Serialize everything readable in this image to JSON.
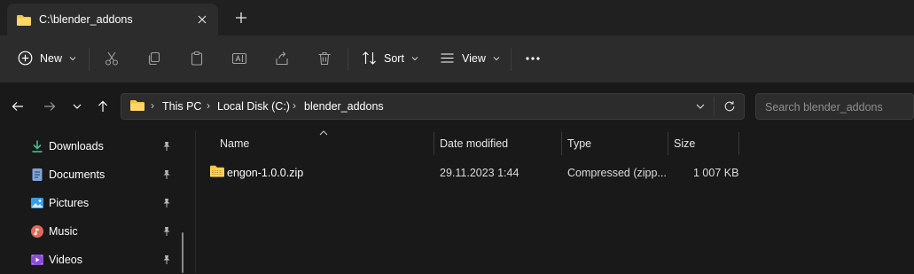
{
  "window": {
    "tab_title": "C:\\blender_addons",
    "new_tab_label": "+"
  },
  "toolbar": {
    "new_label": "New",
    "sort_label": "Sort",
    "view_label": "View",
    "more_label": "···"
  },
  "address": {
    "crumbs": [
      "This PC",
      "Local Disk (C:)",
      "blender_addons"
    ]
  },
  "search": {
    "placeholder": "Search blender_addons",
    "value": ""
  },
  "sidebar": {
    "items": [
      {
        "label": "Downloads",
        "icon": "download-icon"
      },
      {
        "label": "Documents",
        "icon": "document-icon"
      },
      {
        "label": "Pictures",
        "icon": "pictures-icon"
      },
      {
        "label": "Music",
        "icon": "music-icon"
      },
      {
        "label": "Videos",
        "icon": "videos-icon"
      }
    ]
  },
  "file_list": {
    "columns": [
      "Name",
      "Date modified",
      "Type",
      "Size"
    ],
    "rows": [
      {
        "name": "engon-1.0.0.zip",
        "date": "29.11.2023 1:44",
        "type": "Compressed (zipp...",
        "size": "1 007 KB"
      }
    ]
  },
  "colors": {
    "background": "#191919",
    "toolbar": "#2c2c2c",
    "folder": "#f4c542",
    "accent": "#60cdff"
  }
}
